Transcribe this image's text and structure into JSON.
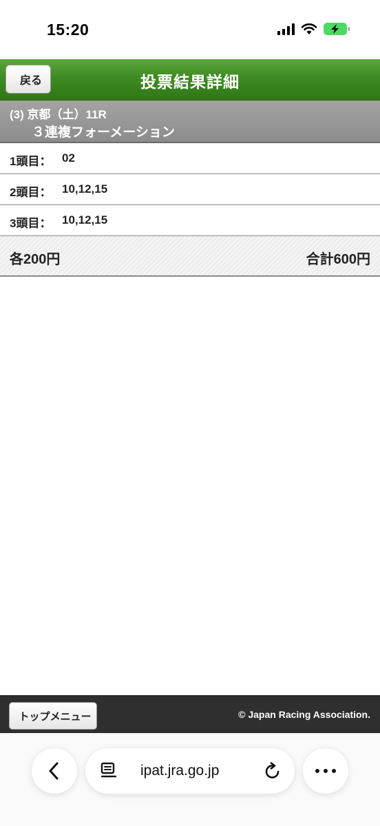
{
  "status_bar": {
    "time": "15:20",
    "icons": [
      "signal-icon",
      "wifi-icon",
      "battery-charging-icon"
    ],
    "battery_color": "#4cd964"
  },
  "header": {
    "back_label": "戻る",
    "title": "投票結果詳細",
    "color": "#3e8a22"
  },
  "race": {
    "line1": "(3) 京都（土）11R",
    "line2": "３連複フォーメーション"
  },
  "selections": [
    {
      "label": "1頭目：",
      "value": "02"
    },
    {
      "label": "2頭目：",
      "value": "10,12,15"
    },
    {
      "label": "3頭目：",
      "value": "10,12,15"
    }
  ],
  "totals": {
    "each": "各200円",
    "sum": "合計600円"
  },
  "footer": {
    "top_menu_label": "トップメニュー",
    "copyright": "© Japan Racing Association."
  },
  "browser": {
    "url": "ipat.jra.go.jp",
    "icons": [
      "chevron-left-icon",
      "reader-icon",
      "reload-icon",
      "more-icon"
    ]
  }
}
